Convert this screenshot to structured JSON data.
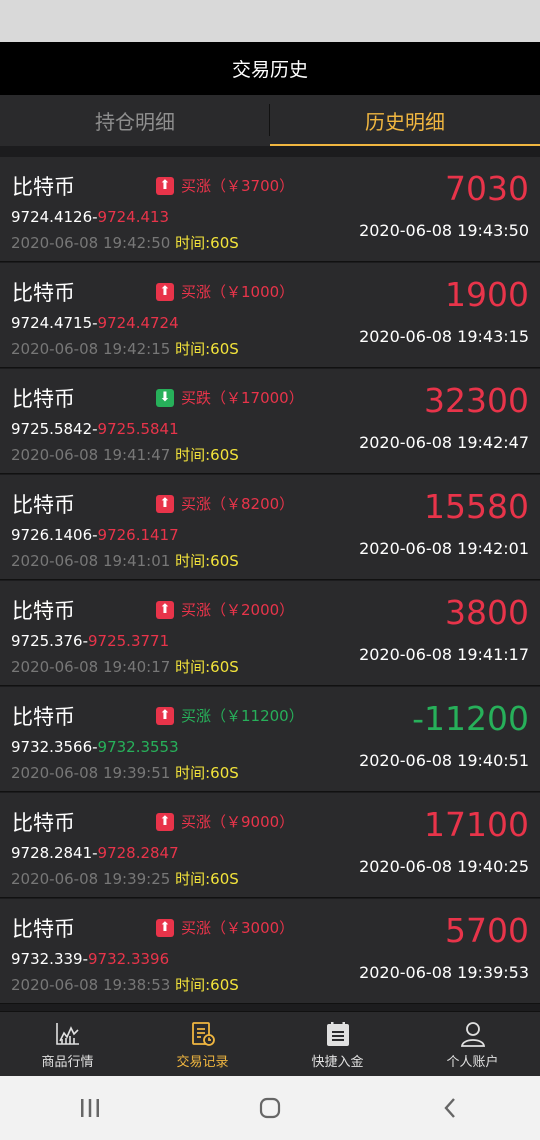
{
  "header": {
    "title": "交易历史"
  },
  "tabs": [
    {
      "label": "持仓明细"
    },
    {
      "label": "历史明细"
    }
  ],
  "records": [
    {
      "name": "比特币",
      "direction": "up",
      "label": "买涨（￥3700）",
      "label_color": "red",
      "open_price": "9724.4126-",
      "close_price": "9724.413",
      "close_color": "red",
      "open_time": "2020-06-08 19:42:50",
      "duration": "时间:60S",
      "profit": "7030",
      "profit_color": "red",
      "close_time": "2020-06-08 19:43:50"
    },
    {
      "name": "比特币",
      "direction": "up",
      "label": "买涨（￥1000）",
      "label_color": "red",
      "open_price": "9724.4715-",
      "close_price": "9724.4724",
      "close_color": "red",
      "open_time": "2020-06-08 19:42:15",
      "duration": "时间:60S",
      "profit": "1900",
      "profit_color": "red",
      "close_time": "2020-06-08 19:43:15"
    },
    {
      "name": "比特币",
      "direction": "down",
      "label": "买跌（￥17000）",
      "label_color": "red",
      "open_price": "9725.5842-",
      "close_price": "9725.5841",
      "close_color": "red",
      "open_time": "2020-06-08 19:41:47",
      "duration": "时间:60S",
      "profit": "32300",
      "profit_color": "red",
      "close_time": "2020-06-08 19:42:47"
    },
    {
      "name": "比特币",
      "direction": "up",
      "label": "买涨（￥8200）",
      "label_color": "red",
      "open_price": "9726.1406-",
      "close_price": "9726.1417",
      "close_color": "red",
      "open_time": "2020-06-08 19:41:01",
      "duration": "时间:60S",
      "profit": "15580",
      "profit_color": "red",
      "close_time": "2020-06-08 19:42:01"
    },
    {
      "name": "比特币",
      "direction": "up",
      "label": "买涨（￥2000）",
      "label_color": "red",
      "open_price": "9725.376-",
      "close_price": "9725.3771",
      "close_color": "red",
      "open_time": "2020-06-08 19:40:17",
      "duration": "时间:60S",
      "profit": "3800",
      "profit_color": "red",
      "close_time": "2020-06-08 19:41:17"
    },
    {
      "name": "比特币",
      "direction": "up",
      "label": "买涨（￥11200）",
      "label_color": "green",
      "open_price": "9732.3566-",
      "close_price": "9732.3553",
      "close_color": "green",
      "open_time": "2020-06-08 19:39:51",
      "duration": "时间:60S",
      "profit": "-11200",
      "profit_color": "green",
      "close_time": "2020-06-08 19:40:51"
    },
    {
      "name": "比特币",
      "direction": "up",
      "label": "买涨（￥9000）",
      "label_color": "red",
      "open_price": "9728.2841-",
      "close_price": "9728.2847",
      "close_color": "red",
      "open_time": "2020-06-08 19:39:25",
      "duration": "时间:60S",
      "profit": "17100",
      "profit_color": "red",
      "close_time": "2020-06-08 19:40:25"
    },
    {
      "name": "比特币",
      "direction": "up",
      "label": "买涨（￥3000）",
      "label_color": "red",
      "open_price": "9732.339-",
      "close_price": "9732.3396",
      "close_color": "red",
      "open_time": "2020-06-08 19:38:53",
      "duration": "时间:60S",
      "profit": "5700",
      "profit_color": "red",
      "close_time": "2020-06-08 19:39:53"
    }
  ],
  "bottom_nav": [
    {
      "label": "商品行情",
      "icon": "chart-icon"
    },
    {
      "label": "交易记录",
      "icon": "record-icon"
    },
    {
      "label": "快捷入金",
      "icon": "deposit-icon"
    },
    {
      "label": "个人账户",
      "icon": "user-icon"
    }
  ],
  "colors": {
    "accent": "#f0b640",
    "red": "#e8344a",
    "green": "#27b05a",
    "yellow": "#f2e33b"
  }
}
